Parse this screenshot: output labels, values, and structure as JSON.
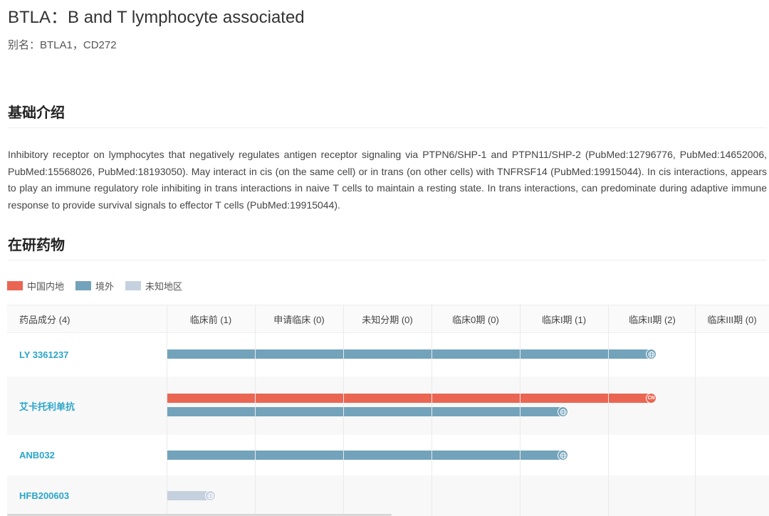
{
  "target": {
    "title": "BTLA：B and T lymphocyte associated",
    "alias": "别名：BTLA1，CD272"
  },
  "sections": {
    "intro_title": "基础介绍",
    "intro_text": "Inhibitory receptor on lymphocytes that negatively regulates antigen receptor signaling via PTPN6/SHP-1 and PTPN11/SHP-2 (PubMed:12796776, PubMed:14652006, PubMed:15568026, PubMed:18193050). May interact in cis (on the same cell) or in trans (on other cells) with TNFRSF14 (PubMed:19915044). In cis interactions, appears to play an immune regulatory role inhibiting in trans interactions in naive T cells to maintain a resting state. In trans interactions, can predominate during adaptive immune response to provide survival signals to effector T cells (PubMed:19915044).",
    "drugs_title": "在研药物"
  },
  "legend": {
    "mainland": "中国内地",
    "overseas": "境外",
    "unknown": "未知地区"
  },
  "colors": {
    "mainland": "#ea6653",
    "overseas": "#72a3bb",
    "unknown": "#c6d1df",
    "link": "#2aa5c9"
  },
  "table": {
    "headers": [
      "药品成分 (4)",
      "临床前 (1)",
      "申请临床 (0)",
      "未知分期 (0)",
      "临床0期 (0)",
      "临床I期 (1)",
      "临床II期 (2)",
      "临床III期 (0)"
    ],
    "drugs": [
      {
        "name": "LY 3361237",
        "bars": [
          {
            "region": "overseas",
            "icon": "globe-icon",
            "phase_reached": "临床II期"
          }
        ]
      },
      {
        "name": "艾卡托利单抗",
        "bars": [
          {
            "region": "mainland",
            "label": "CN",
            "phase_reached": "临床II期"
          },
          {
            "region": "overseas",
            "icon": "globe-icon",
            "phase_reached": "临床I期"
          }
        ]
      },
      {
        "name": "ANB032",
        "bars": [
          {
            "region": "overseas",
            "icon": "globe-icon",
            "phase_reached": "临床I期"
          }
        ]
      },
      {
        "name": "HFB200603",
        "bars": [
          {
            "region": "unknown",
            "icon": "globe-icon",
            "phase_reached": "临床前"
          }
        ]
      }
    ]
  }
}
